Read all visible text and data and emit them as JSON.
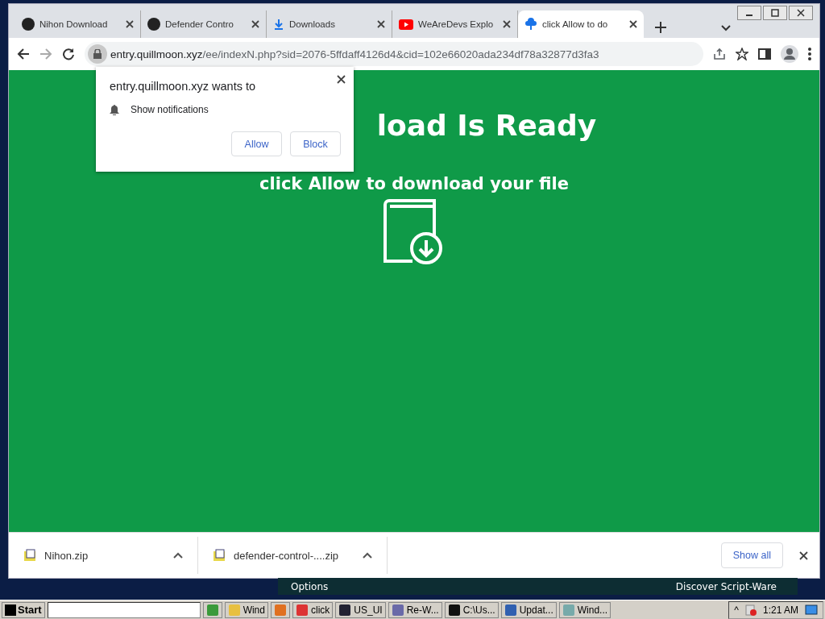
{
  "browser": {
    "tabs": [
      {
        "title": "Nihon Download",
        "selected": false
      },
      {
        "title": "Defender Contro",
        "selected": false
      },
      {
        "title": "Downloads",
        "selected": false
      },
      {
        "title": "WeAreDevs Explo",
        "selected": false
      },
      {
        "title": "click Allow to do",
        "selected": true
      }
    ],
    "address": {
      "host": "entry.quillmoon.xyz",
      "path": "/ee/indexN.php?sid=2076-5ffdaff4126d4&cid=102e66020ada234df78a32877d3fa3"
    }
  },
  "page": {
    "heading": "load Is Ready",
    "subtitle": "click Allow to download your file"
  },
  "permission_popup": {
    "title": "entry.quillmoon.xyz wants to",
    "permission": "Show notifications",
    "buttons": [
      "Allow",
      "Block"
    ]
  },
  "download_shelf": {
    "items": [
      {
        "name": "Nihon.zip"
      },
      {
        "name": "defender-control-....zip"
      }
    ],
    "show_all": "Show all"
  },
  "background_app": {
    "left_label": "Options",
    "right_label": "Discover Script-Ware"
  },
  "taskbar": {
    "start": "Start",
    "items": [
      {
        "kind": "icon"
      },
      {
        "kind": "window",
        "label": "Wind"
      },
      {
        "kind": "icon"
      },
      {
        "kind": "window",
        "label": "click"
      },
      {
        "kind": "window",
        "label": "US_UI"
      },
      {
        "kind": "window",
        "label": "Re-W..."
      },
      {
        "kind": "window",
        "label": "C:\\Us..."
      },
      {
        "kind": "window",
        "label": "Updat..."
      },
      {
        "kind": "window",
        "label": "Wind..."
      }
    ],
    "clock": "1:21 AM",
    "tray_arrow": "^"
  }
}
